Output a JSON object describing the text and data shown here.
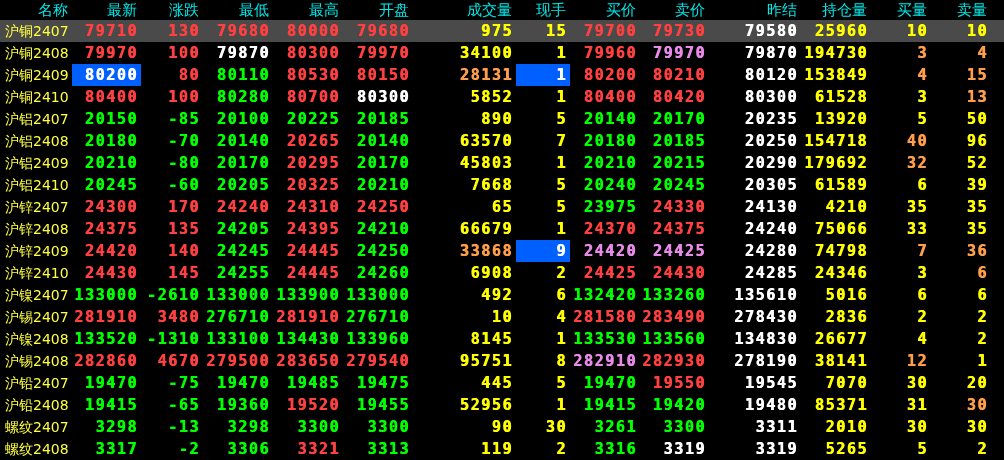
{
  "table": {
    "name_column": "名称",
    "columns": [
      "最新",
      "涨跌",
      "最低",
      "最高",
      "开盘",
      "成交量",
      "现手",
      "买价",
      "卖价",
      "昨结",
      "持仓量",
      "买量",
      "卖量"
    ],
    "rows": [
      {
        "name": "沪铜2407",
        "selected": true,
        "cells": [
          {
            "text": "79710",
            "color": "#ff4040"
          },
          {
            "text": "130",
            "color": "#ff4040"
          },
          {
            "text": "79680",
            "color": "#ff4040"
          },
          {
            "text": "80000",
            "color": "#ff4040"
          },
          {
            "text": "79680",
            "color": "#ff4040"
          },
          {
            "text": "975",
            "color": "#ffff00"
          },
          {
            "text": "15",
            "color": "#ffff00"
          },
          {
            "text": "79700",
            "color": "#ff4040"
          },
          {
            "text": "79730",
            "color": "#ff4040"
          },
          {
            "text": "79580",
            "color": "#ffffff"
          },
          {
            "text": "25960",
            "color": "#ffff00"
          },
          {
            "text": "10",
            "color": "#ffff00"
          },
          {
            "text": "10",
            "color": "#ffff00"
          }
        ]
      },
      {
        "name": "沪铜2408",
        "selected": false,
        "cells": [
          {
            "text": "79970",
            "color": "#ff4040"
          },
          {
            "text": "100",
            "color": "#ff4040"
          },
          {
            "text": "79870",
            "color": "#ffffff"
          },
          {
            "text": "80300",
            "color": "#ff4040"
          },
          {
            "text": "79970",
            "color": "#ff4040"
          },
          {
            "text": "34100",
            "color": "#ffff00"
          },
          {
            "text": "1",
            "color": "#ffff00"
          },
          {
            "text": "79960",
            "color": "#ff4040"
          },
          {
            "text": "79970",
            "color": "#e88be8"
          },
          {
            "text": "79870",
            "color": "#ffffff"
          },
          {
            "text": "194730",
            "color": "#ffff00"
          },
          {
            "text": "3",
            "color": "#ff9e4a"
          },
          {
            "text": "4",
            "color": "#ff9e4a"
          }
        ]
      },
      {
        "name": "沪铜2409",
        "selected": false,
        "cells": [
          {
            "text": "80200",
            "color": "#ffffff",
            "flash": true
          },
          {
            "text": "80",
            "color": "#ff4040"
          },
          {
            "text": "80110",
            "color": "#00ff00"
          },
          {
            "text": "80530",
            "color": "#ff4040"
          },
          {
            "text": "80150",
            "color": "#ff4040"
          },
          {
            "text": "28131",
            "color": "#ff9e4a"
          },
          {
            "text": "1",
            "color": "#ffffff",
            "flash": true
          },
          {
            "text": "80200",
            "color": "#ff4040"
          },
          {
            "text": "80210",
            "color": "#ff4040"
          },
          {
            "text": "80120",
            "color": "#ffffff"
          },
          {
            "text": "153849",
            "color": "#ffff00"
          },
          {
            "text": "4",
            "color": "#ff9e4a"
          },
          {
            "text": "15",
            "color": "#ff9e4a"
          }
        ]
      },
      {
        "name": "沪铜2410",
        "selected": false,
        "cells": [
          {
            "text": "80400",
            "color": "#ff4040"
          },
          {
            "text": "100",
            "color": "#ff4040"
          },
          {
            "text": "80280",
            "color": "#00ff00"
          },
          {
            "text": "80700",
            "color": "#ff4040"
          },
          {
            "text": "80300",
            "color": "#ffffff"
          },
          {
            "text": "5852",
            "color": "#ffff00"
          },
          {
            "text": "1",
            "color": "#ffff00"
          },
          {
            "text": "80400",
            "color": "#ff4040"
          },
          {
            "text": "80420",
            "color": "#ff4040"
          },
          {
            "text": "80300",
            "color": "#ffffff"
          },
          {
            "text": "61528",
            "color": "#ffff00"
          },
          {
            "text": "3",
            "color": "#ffff00"
          },
          {
            "text": "13",
            "color": "#ff9e4a"
          }
        ]
      },
      {
        "name": "沪铝2407",
        "selected": false,
        "cells": [
          {
            "text": "20150",
            "color": "#00ff00"
          },
          {
            "text": "-85",
            "color": "#00ff00"
          },
          {
            "text": "20100",
            "color": "#00ff00"
          },
          {
            "text": "20225",
            "color": "#00ff00"
          },
          {
            "text": "20185",
            "color": "#00ff00"
          },
          {
            "text": "890",
            "color": "#ffff00"
          },
          {
            "text": "5",
            "color": "#ffff00"
          },
          {
            "text": "20140",
            "color": "#00ff00"
          },
          {
            "text": "20170",
            "color": "#00ff00"
          },
          {
            "text": "20235",
            "color": "#ffffff"
          },
          {
            "text": "13920",
            "color": "#ffff00"
          },
          {
            "text": "5",
            "color": "#ffff00"
          },
          {
            "text": "50",
            "color": "#ffff00"
          }
        ]
      },
      {
        "name": "沪铝2408",
        "selected": false,
        "cells": [
          {
            "text": "20180",
            "color": "#00ff00"
          },
          {
            "text": "-70",
            "color": "#00ff00"
          },
          {
            "text": "20140",
            "color": "#00ff00"
          },
          {
            "text": "20265",
            "color": "#ff4040"
          },
          {
            "text": "20140",
            "color": "#00ff00"
          },
          {
            "text": "63570",
            "color": "#ffff00"
          },
          {
            "text": "7",
            "color": "#ffff00"
          },
          {
            "text": "20180",
            "color": "#00ff00"
          },
          {
            "text": "20185",
            "color": "#00ff00"
          },
          {
            "text": "20250",
            "color": "#ffffff"
          },
          {
            "text": "154718",
            "color": "#ffff00"
          },
          {
            "text": "40",
            "color": "#ff9e4a"
          },
          {
            "text": "96",
            "color": "#ffff00"
          }
        ]
      },
      {
        "name": "沪铝2409",
        "selected": false,
        "cells": [
          {
            "text": "20210",
            "color": "#00ff00"
          },
          {
            "text": "-80",
            "color": "#00ff00"
          },
          {
            "text": "20170",
            "color": "#00ff00"
          },
          {
            "text": "20295",
            "color": "#ff4040"
          },
          {
            "text": "20170",
            "color": "#00ff00"
          },
          {
            "text": "45803",
            "color": "#ffff00"
          },
          {
            "text": "1",
            "color": "#ffff00"
          },
          {
            "text": "20210",
            "color": "#00ff00"
          },
          {
            "text": "20215",
            "color": "#00ff00"
          },
          {
            "text": "20290",
            "color": "#ffffff"
          },
          {
            "text": "179692",
            "color": "#ffff00"
          },
          {
            "text": "32",
            "color": "#ff9e4a"
          },
          {
            "text": "52",
            "color": "#ffff00"
          }
        ]
      },
      {
        "name": "沪铝2410",
        "selected": false,
        "cells": [
          {
            "text": "20245",
            "color": "#00ff00"
          },
          {
            "text": "-60",
            "color": "#00ff00"
          },
          {
            "text": "20205",
            "color": "#00ff00"
          },
          {
            "text": "20325",
            "color": "#ff4040"
          },
          {
            "text": "20210",
            "color": "#00ff00"
          },
          {
            "text": "7668",
            "color": "#ffff00"
          },
          {
            "text": "5",
            "color": "#ffff00"
          },
          {
            "text": "20240",
            "color": "#00ff00"
          },
          {
            "text": "20245",
            "color": "#00ff00"
          },
          {
            "text": "20305",
            "color": "#ffffff"
          },
          {
            "text": "61589",
            "color": "#ffff00"
          },
          {
            "text": "6",
            "color": "#ffff00"
          },
          {
            "text": "39",
            "color": "#ffff00"
          }
        ]
      },
      {
        "name": "沪锌2407",
        "selected": false,
        "cells": [
          {
            "text": "24300",
            "color": "#ff4040"
          },
          {
            "text": "170",
            "color": "#ff4040"
          },
          {
            "text": "24240",
            "color": "#ff4040"
          },
          {
            "text": "24310",
            "color": "#ff4040"
          },
          {
            "text": "24250",
            "color": "#ff4040"
          },
          {
            "text": "65",
            "color": "#ffff00"
          },
          {
            "text": "5",
            "color": "#ffff00"
          },
          {
            "text": "23975",
            "color": "#00ff00"
          },
          {
            "text": "24330",
            "color": "#ff4040"
          },
          {
            "text": "24130",
            "color": "#ffffff"
          },
          {
            "text": "4210",
            "color": "#ffff00"
          },
          {
            "text": "35",
            "color": "#ffff00"
          },
          {
            "text": "35",
            "color": "#ffff00"
          }
        ]
      },
      {
        "name": "沪锌2408",
        "selected": false,
        "cells": [
          {
            "text": "24375",
            "color": "#ff4040"
          },
          {
            "text": "135",
            "color": "#ff4040"
          },
          {
            "text": "24205",
            "color": "#00ff00"
          },
          {
            "text": "24395",
            "color": "#ff4040"
          },
          {
            "text": "24210",
            "color": "#00ff00"
          },
          {
            "text": "66679",
            "color": "#ffff00"
          },
          {
            "text": "1",
            "color": "#ffff00"
          },
          {
            "text": "24370",
            "color": "#ff4040"
          },
          {
            "text": "24375",
            "color": "#ff4040"
          },
          {
            "text": "24240",
            "color": "#ffffff"
          },
          {
            "text": "75066",
            "color": "#ffff00"
          },
          {
            "text": "33",
            "color": "#ffff00"
          },
          {
            "text": "35",
            "color": "#ffff00"
          }
        ]
      },
      {
        "name": "沪锌2409",
        "selected": false,
        "cells": [
          {
            "text": "24420",
            "color": "#ff4040"
          },
          {
            "text": "140",
            "color": "#ff4040"
          },
          {
            "text": "24245",
            "color": "#00ff00"
          },
          {
            "text": "24445",
            "color": "#ff4040"
          },
          {
            "text": "24250",
            "color": "#00ff00"
          },
          {
            "text": "33868",
            "color": "#ff9e4a"
          },
          {
            "text": "9",
            "color": "#ffffff",
            "flash": true
          },
          {
            "text": "24420",
            "color": "#e88be8"
          },
          {
            "text": "24425",
            "color": "#e88be8"
          },
          {
            "text": "24280",
            "color": "#ffffff"
          },
          {
            "text": "74798",
            "color": "#ffff00"
          },
          {
            "text": "7",
            "color": "#ff9e4a"
          },
          {
            "text": "36",
            "color": "#ff9e4a"
          }
        ]
      },
      {
        "name": "沪锌2410",
        "selected": false,
        "cells": [
          {
            "text": "24430",
            "color": "#ff4040"
          },
          {
            "text": "145",
            "color": "#ff4040"
          },
          {
            "text": "24255",
            "color": "#00ff00"
          },
          {
            "text": "24445",
            "color": "#ff4040"
          },
          {
            "text": "24260",
            "color": "#00ff00"
          },
          {
            "text": "6908",
            "color": "#ffff00"
          },
          {
            "text": "2",
            "color": "#ffff00"
          },
          {
            "text": "24425",
            "color": "#ff4040"
          },
          {
            "text": "24430",
            "color": "#ff4040"
          },
          {
            "text": "24285",
            "color": "#ffffff"
          },
          {
            "text": "24346",
            "color": "#ffff00"
          },
          {
            "text": "3",
            "color": "#ffff00"
          },
          {
            "text": "6",
            "color": "#ff9e4a"
          }
        ]
      },
      {
        "name": "沪镍2407",
        "selected": false,
        "cells": [
          {
            "text": "133000",
            "color": "#00ff00"
          },
          {
            "text": "-2610",
            "color": "#00ff00"
          },
          {
            "text": "133000",
            "color": "#00ff00"
          },
          {
            "text": "133900",
            "color": "#00ff00"
          },
          {
            "text": "133000",
            "color": "#00ff00"
          },
          {
            "text": "492",
            "color": "#ffff00"
          },
          {
            "text": "6",
            "color": "#ffff00"
          },
          {
            "text": "132420",
            "color": "#00ff00"
          },
          {
            "text": "133260",
            "color": "#00ff00"
          },
          {
            "text": "135610",
            "color": "#ffffff"
          },
          {
            "text": "5016",
            "color": "#ffff00"
          },
          {
            "text": "6",
            "color": "#ffff00"
          },
          {
            "text": "6",
            "color": "#ffff00"
          }
        ]
      },
      {
        "name": "沪锡2407",
        "selected": false,
        "cells": [
          {
            "text": "281910",
            "color": "#ff4040"
          },
          {
            "text": "3480",
            "color": "#ff4040"
          },
          {
            "text": "276710",
            "color": "#00ff00"
          },
          {
            "text": "281910",
            "color": "#ff4040"
          },
          {
            "text": "276710",
            "color": "#00ff00"
          },
          {
            "text": "10",
            "color": "#ffff00"
          },
          {
            "text": "4",
            "color": "#ffff00"
          },
          {
            "text": "281580",
            "color": "#ff4040"
          },
          {
            "text": "283490",
            "color": "#ff4040"
          },
          {
            "text": "278430",
            "color": "#ffffff"
          },
          {
            "text": "2836",
            "color": "#ffff00"
          },
          {
            "text": "2",
            "color": "#ffff00"
          },
          {
            "text": "2",
            "color": "#ffff00"
          }
        ]
      },
      {
        "name": "沪镍2408",
        "selected": false,
        "cells": [
          {
            "text": "133520",
            "color": "#00ff00"
          },
          {
            "text": "-1310",
            "color": "#00ff00"
          },
          {
            "text": "133100",
            "color": "#00ff00"
          },
          {
            "text": "134430",
            "color": "#00ff00"
          },
          {
            "text": "133960",
            "color": "#00ff00"
          },
          {
            "text": "8145",
            "color": "#ffff00"
          },
          {
            "text": "1",
            "color": "#ffff00"
          },
          {
            "text": "133530",
            "color": "#00ff00"
          },
          {
            "text": "133560",
            "color": "#00ff00"
          },
          {
            "text": "134830",
            "color": "#ffffff"
          },
          {
            "text": "26677",
            "color": "#ffff00"
          },
          {
            "text": "4",
            "color": "#ffff00"
          },
          {
            "text": "2",
            "color": "#ffff00"
          }
        ]
      },
      {
        "name": "沪锡2408",
        "selected": false,
        "cells": [
          {
            "text": "282860",
            "color": "#ff4040"
          },
          {
            "text": "4670",
            "color": "#ff4040"
          },
          {
            "text": "279500",
            "color": "#ff4040"
          },
          {
            "text": "283650",
            "color": "#ff4040"
          },
          {
            "text": "279540",
            "color": "#ff4040"
          },
          {
            "text": "95751",
            "color": "#ffff00"
          },
          {
            "text": "8",
            "color": "#ffff00"
          },
          {
            "text": "282910",
            "color": "#e88be8"
          },
          {
            "text": "282930",
            "color": "#ff4040"
          },
          {
            "text": "278190",
            "color": "#ffffff"
          },
          {
            "text": "38141",
            "color": "#ffff00"
          },
          {
            "text": "12",
            "color": "#ff9e4a"
          },
          {
            "text": "1",
            "color": "#ffff00"
          }
        ]
      },
      {
        "name": "沪铅2407",
        "selected": false,
        "cells": [
          {
            "text": "19470",
            "color": "#00ff00"
          },
          {
            "text": "-75",
            "color": "#00ff00"
          },
          {
            "text": "19470",
            "color": "#00ff00"
          },
          {
            "text": "19485",
            "color": "#00ff00"
          },
          {
            "text": "19475",
            "color": "#00ff00"
          },
          {
            "text": "445",
            "color": "#ffff00"
          },
          {
            "text": "5",
            "color": "#ffff00"
          },
          {
            "text": "19470",
            "color": "#00ff00"
          },
          {
            "text": "19550",
            "color": "#ff4040"
          },
          {
            "text": "19545",
            "color": "#ffffff"
          },
          {
            "text": "7070",
            "color": "#ffff00"
          },
          {
            "text": "30",
            "color": "#ffff00"
          },
          {
            "text": "20",
            "color": "#ffff00"
          }
        ]
      },
      {
        "name": "沪铅2408",
        "selected": false,
        "cells": [
          {
            "text": "19415",
            "color": "#00ff00"
          },
          {
            "text": "-65",
            "color": "#00ff00"
          },
          {
            "text": "19360",
            "color": "#00ff00"
          },
          {
            "text": "19520",
            "color": "#ff4040"
          },
          {
            "text": "19455",
            "color": "#00ff00"
          },
          {
            "text": "52956",
            "color": "#ffff00"
          },
          {
            "text": "1",
            "color": "#ffff00"
          },
          {
            "text": "19415",
            "color": "#00ff00"
          },
          {
            "text": "19420",
            "color": "#00ff00"
          },
          {
            "text": "19480",
            "color": "#ffffff"
          },
          {
            "text": "85371",
            "color": "#ffff00"
          },
          {
            "text": "31",
            "color": "#ffff00"
          },
          {
            "text": "30",
            "color": "#ff9e4a"
          }
        ]
      },
      {
        "name": "螺纹2407",
        "selected": false,
        "cells": [
          {
            "text": "3298",
            "color": "#00ff00"
          },
          {
            "text": "-13",
            "color": "#00ff00"
          },
          {
            "text": "3298",
            "color": "#00ff00"
          },
          {
            "text": "3300",
            "color": "#00ff00"
          },
          {
            "text": "3300",
            "color": "#00ff00"
          },
          {
            "text": "90",
            "color": "#ffff00"
          },
          {
            "text": "30",
            "color": "#ffff00"
          },
          {
            "text": "3261",
            "color": "#00ff00"
          },
          {
            "text": "3300",
            "color": "#00ff00"
          },
          {
            "text": "3311",
            "color": "#ffffff"
          },
          {
            "text": "2010",
            "color": "#ffff00"
          },
          {
            "text": "30",
            "color": "#ffff00"
          },
          {
            "text": "30",
            "color": "#ffff00"
          }
        ]
      },
      {
        "name": "螺纹2408",
        "selected": false,
        "cells": [
          {
            "text": "3317",
            "color": "#00ff00"
          },
          {
            "text": "-2",
            "color": "#00ff00"
          },
          {
            "text": "3306",
            "color": "#00ff00"
          },
          {
            "text": "3321",
            "color": "#ff4040"
          },
          {
            "text": "3313",
            "color": "#00ff00"
          },
          {
            "text": "119",
            "color": "#ffff00"
          },
          {
            "text": "2",
            "color": "#ffff00"
          },
          {
            "text": "3316",
            "color": "#00ff00"
          },
          {
            "text": "3319",
            "color": "#ffffff"
          },
          {
            "text": "3319",
            "color": "#ffffff"
          },
          {
            "text": "5265",
            "color": "#ffff00"
          },
          {
            "text": "5",
            "color": "#ffff00"
          },
          {
            "text": "2",
            "color": "#ffff00"
          }
        ]
      }
    ]
  }
}
